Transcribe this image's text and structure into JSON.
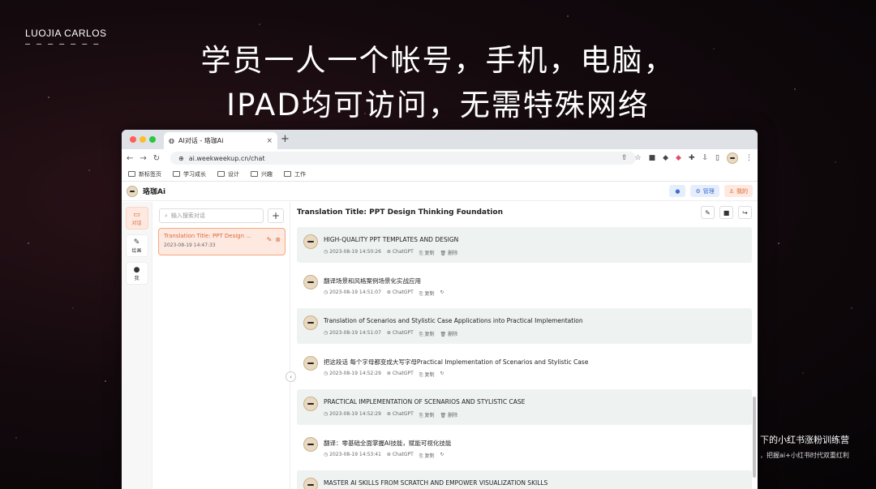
{
  "overlay": {
    "brand": "LUOJIA CARLOS",
    "brand_underline": "– – – – – – –",
    "headline_line1": "学员一人一个帐号，手机，电脑，",
    "headline_line2": "IPAD均可访问，无需特殊网络",
    "side_caption_1": "下的小红书涨粉训练营",
    "side_caption_2": "，把握ai+小红书时代双重红利"
  },
  "browser": {
    "tab_title": "AI对话 - 珞珈Ai",
    "tab_close": "×",
    "new_tab": "+",
    "url": "ai.weekweekup.cn/chat",
    "nav_back": "←",
    "nav_forward": "→",
    "nav_reload": "↻",
    "bookmarks": [
      "新标签页",
      "学习成长",
      "设计",
      "兴趣",
      "工作"
    ]
  },
  "app": {
    "title": "珞珈Ai",
    "wechat_label": "●",
    "admin_label": "管理",
    "mine_label": "我的"
  },
  "rail": [
    {
      "label": "对话",
      "icon": "chat-icon"
    },
    {
      "label": "绘画",
      "icon": "brush-icon"
    },
    {
      "label": "我",
      "icon": "person-icon"
    }
  ],
  "sidebar": {
    "search_placeholder": "输入搜索对话",
    "add_label": "+",
    "conversation": {
      "title": "Translation Title: PPT Design ...",
      "time": "2023-08-19 14:47:33"
    }
  },
  "chat": {
    "title": "Translation Title: PPT Design Thinking Foundation",
    "messages": [
      {
        "role": "bot",
        "text": "HIGH-QUALITY PPT TEMPLATES AND DESIGN",
        "time": "2023-08-19 14:50:26",
        "model": "ChatGPT",
        "copy": "复制",
        "extra": "删除"
      },
      {
        "role": "user",
        "text": "翻译场景和风格案例场景化实战应用",
        "time": "2023-08-19 14:51:07",
        "model": "ChatGPT",
        "copy": "复制",
        "extra": "↻"
      },
      {
        "role": "bot",
        "text": "Translation of Scenarios and Stylistic Case Applications into Practical Implementation",
        "time": "2023-08-19 14:51:07",
        "model": "ChatGPT",
        "copy": "复制",
        "extra": "删除"
      },
      {
        "role": "user",
        "text": "把这段话 每个字母都变成大写字母Practical Implementation of  Scenarios and Stylistic Case",
        "time": "2023-08-19 14:52:29",
        "model": "ChatGPT",
        "copy": "复制",
        "extra": "↻"
      },
      {
        "role": "bot",
        "text": "PRACTICAL IMPLEMENTATION OF SCENARIOS AND STYLISTIC CASE",
        "time": "2023-08-19 14:52:29",
        "model": "ChatGPT",
        "copy": "复制",
        "extra": "删除"
      },
      {
        "role": "user",
        "text": "翻译：零基础全面掌握AI技能，赋能可视化技能",
        "time": "2023-08-19 14:53:41",
        "model": "ChatGPT",
        "copy": "复制",
        "extra": "↻"
      },
      {
        "role": "bot",
        "text": "MASTER AI SKILLS FROM SCRATCH AND EMPOWER VISUALIZATION SKILLS",
        "time": "",
        "model": "",
        "copy": "",
        "extra": ""
      }
    ]
  }
}
